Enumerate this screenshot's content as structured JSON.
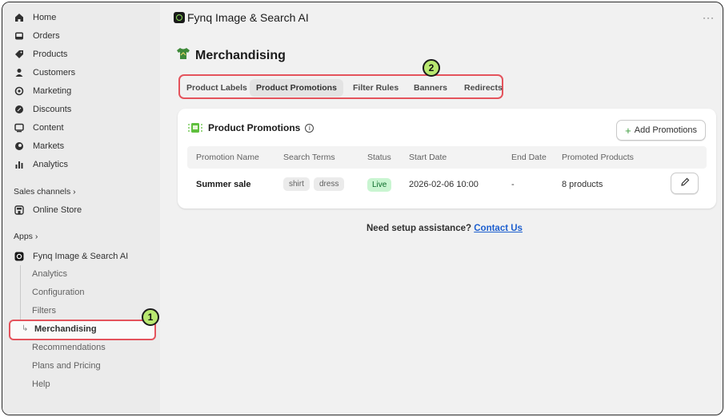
{
  "sidebar": {
    "nav": [
      {
        "label": "Home",
        "icon": "home-icon"
      },
      {
        "label": "Orders",
        "icon": "inbox-icon"
      },
      {
        "label": "Products",
        "icon": "tag-icon"
      },
      {
        "label": "Customers",
        "icon": "person-icon"
      },
      {
        "label": "Marketing",
        "icon": "target-icon"
      },
      {
        "label": "Discounts",
        "icon": "discount-icon"
      },
      {
        "label": "Content",
        "icon": "image-icon"
      },
      {
        "label": "Markets",
        "icon": "globe-icon"
      },
      {
        "label": "Analytics",
        "icon": "bar-chart-icon"
      }
    ],
    "sales_channels_label": "Sales channels",
    "online_store_label": "Online Store",
    "apps_label": "Apps",
    "app_name": "Fynq Image & Search AI",
    "app_sub": [
      "Analytics",
      "Configuration",
      "Filters",
      "Merchandising",
      "Recommendations",
      "Plans and Pricing",
      "Help"
    ],
    "active_sub": "Merchandising"
  },
  "badges": {
    "one": "1",
    "two": "2"
  },
  "header": {
    "app_title": "Fynq Image & Search AI",
    "more": "···"
  },
  "page": {
    "title": "Merchandising"
  },
  "tabs": [
    "Product Labels",
    "Product Promotions",
    "Filter Rules",
    "Banners",
    "Redirects"
  ],
  "active_tab": "Product Promotions",
  "card": {
    "title": "Product Promotions",
    "info": "i",
    "add_button": "Add Promotions",
    "columns": [
      "Promotion Name",
      "Search Terms",
      "Status",
      "Start Date",
      "End Date",
      "Promoted Products"
    ],
    "rows": [
      {
        "name": "Summer sale",
        "terms": [
          "shirt",
          "dress"
        ],
        "status": "Live",
        "start": "2026-02-06 10:00",
        "end": "-",
        "products": "8 products"
      }
    ]
  },
  "assist": {
    "text": "Need setup assistance?",
    "link": "Contact Us"
  },
  "colors": {
    "highlight": "#e4535c",
    "badge": "#b9e870",
    "live_bg": "#c9f5d1",
    "link": "#1d5fcf"
  }
}
